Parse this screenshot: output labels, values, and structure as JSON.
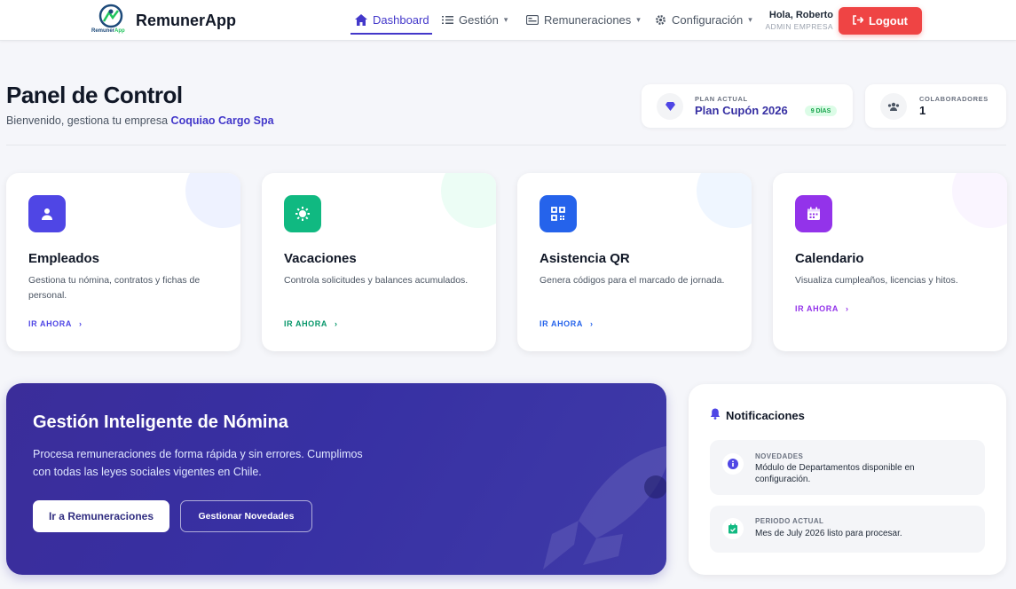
{
  "nav": {
    "logo_text_a": "Remuner",
    "logo_text_b": "App",
    "brand": "RemunerApp",
    "items": [
      {
        "label": "Dashboard"
      },
      {
        "label": "Gestión"
      },
      {
        "label": "Remuneraciones"
      },
      {
        "label": "Configuración"
      }
    ],
    "greeting": "Hola, Roberto",
    "role": "ADMIN EMPRESA",
    "logout_label": "Logout"
  },
  "header": {
    "title": "Panel de Control",
    "welcome_prefix": "Bienvenido, gestiona tu empresa",
    "company": "Coquiao Cargo Spa"
  },
  "stats": {
    "plan_label": "PLAN ACTUAL",
    "plan_value": "Plan Cupón 2026",
    "plan_badge": "9 DÍAS",
    "collab_label": "COLABORADORES",
    "collab_value": "1"
  },
  "cards": [
    {
      "title": "Empleados",
      "desc": "Gestiona tu nómina, contratos y fichas de personal.",
      "link": "IR AHORA",
      "color": "#4f46e5"
    },
    {
      "title": "Vacaciones",
      "desc": "Controla solicitudes y balances acumulados.",
      "link": "IR AHORA",
      "color": "#10b981"
    },
    {
      "title": "Asistencia QR",
      "desc": "Genera códigos para el marcado de jornada.",
      "link": "IR AHORA",
      "color": "#2563eb"
    },
    {
      "title": "Calendario",
      "desc": "Visualiza cumpleaños, licencias y hitos.",
      "link": "IR AHORA",
      "color": "#9333ea"
    }
  ],
  "hero": {
    "title": "Gestión Inteligente de Nómina",
    "desc": "Procesa remuneraciones de forma rápida y sin errores. Cumplimos con todas las leyes sociales vigentes en Chile.",
    "primary_btn": "Ir a Remuneraciones",
    "secondary_btn": "Gestionar Novedades"
  },
  "notifications": {
    "title": "Notificaciones",
    "items": [
      {
        "label": "NOVEDADES",
        "text": "Módulo de Departamentos disponible en configuración."
      },
      {
        "label": "PERIODO ACTUAL",
        "text": "Mes de July 2026 listo para procesar."
      }
    ]
  }
}
